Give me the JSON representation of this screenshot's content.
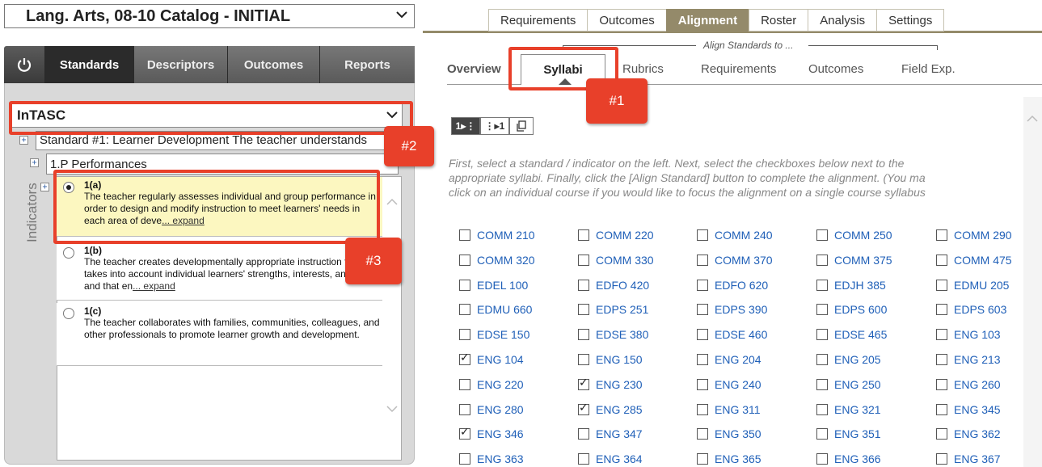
{
  "catalog": {
    "title": "Lang. Arts, 08-10 Catalog - INITIAL"
  },
  "top_tabs": [
    "Requirements",
    "Outcomes",
    "Alignment",
    "Roster",
    "Analysis",
    "Settings"
  ],
  "left_nav": {
    "tabs": [
      "Standards",
      "Descriptors",
      "Outcomes",
      "Reports"
    ]
  },
  "standards_set": "InTASC",
  "standard": "Standard #1: Learner Development The teacher understands",
  "performance_group": "1.P Performances",
  "indicators_label": "Indicators",
  "indicators": [
    {
      "code": "1(a)",
      "text": "The teacher regularly assesses individual and group performance in order to design and modify instruction to meet learners' needs in each area of deve",
      "expand": "... expand",
      "selected": true
    },
    {
      "code": "1(b)",
      "text": "The teacher creates developmentally appropriate instruction that takes into account individual learners' strengths, interests, and needs and that en",
      "expand": "... expand",
      "selected": false
    },
    {
      "code": "1(c)",
      "text": "The teacher collaborates with families, communities, colleagues, and other professionals to promote learner growth and development.",
      "expand": "",
      "selected": false
    }
  ],
  "sub_tabs": {
    "overview": "Overview",
    "syllabi": "Syllabi",
    "rubrics": "Rubrics",
    "requirements": "Requirements",
    "outcomes": "Outcomes",
    "field_exp": "Field Exp.",
    "align_to": "Align Standards to ..."
  },
  "view_buttons": [
    "1▸⋮",
    "⋮▸1"
  ],
  "instructions": [
    "First, select a standard / indicator on the left. Next, select the checkboxes below next to the",
    "appropriate syllabi. Finally, click the [Align Standard] button to complete the alignment. (You ma",
    "click on an individual course if you would like to focus the alignment on a single course syllabus"
  ],
  "courses": [
    [
      "COMM 210",
      "COMM 220",
      "COMM 240",
      "COMM 250",
      "COMM 290"
    ],
    [
      "COMM 320",
      "COMM 330",
      "COMM 370",
      "COMM 375",
      "COMM 475"
    ],
    [
      "EDEL 100",
      "EDFO 420",
      "EDFO 620",
      "EDJH 385",
      "EDMU 205"
    ],
    [
      "EDMU 660",
      "EDPS 251",
      "EDPS 390",
      "EDPS 600",
      "EDPS 603"
    ],
    [
      "EDSE 150",
      "EDSE 380",
      "EDSE 460",
      "EDSE 465",
      "ENG 103"
    ],
    [
      "ENG 104",
      "ENG 150",
      "ENG 204",
      "ENG 205",
      "ENG 213"
    ],
    [
      "ENG 220",
      "ENG 230",
      "ENG 240",
      "ENG 250",
      "ENG 260"
    ],
    [
      "ENG 280",
      "ENG 285",
      "ENG 311",
      "ENG 321",
      "ENG 345"
    ],
    [
      "ENG 346",
      "ENG 347",
      "ENG 350",
      "ENG 351",
      "ENG 362"
    ],
    [
      "ENG 363",
      "ENG 364",
      "ENG 365",
      "ENG 366",
      "ENG 367"
    ]
  ],
  "checked_courses": [
    "ENG 104",
    "ENG 230",
    "ENG 285",
    "ENG 346"
  ],
  "callouts": [
    "#1",
    "#2",
    "#3"
  ],
  "colors": {
    "accent": "#948a6a",
    "link": "#2060b8",
    "callout": "#e8402a",
    "highlight": "#fcf7c0"
  }
}
